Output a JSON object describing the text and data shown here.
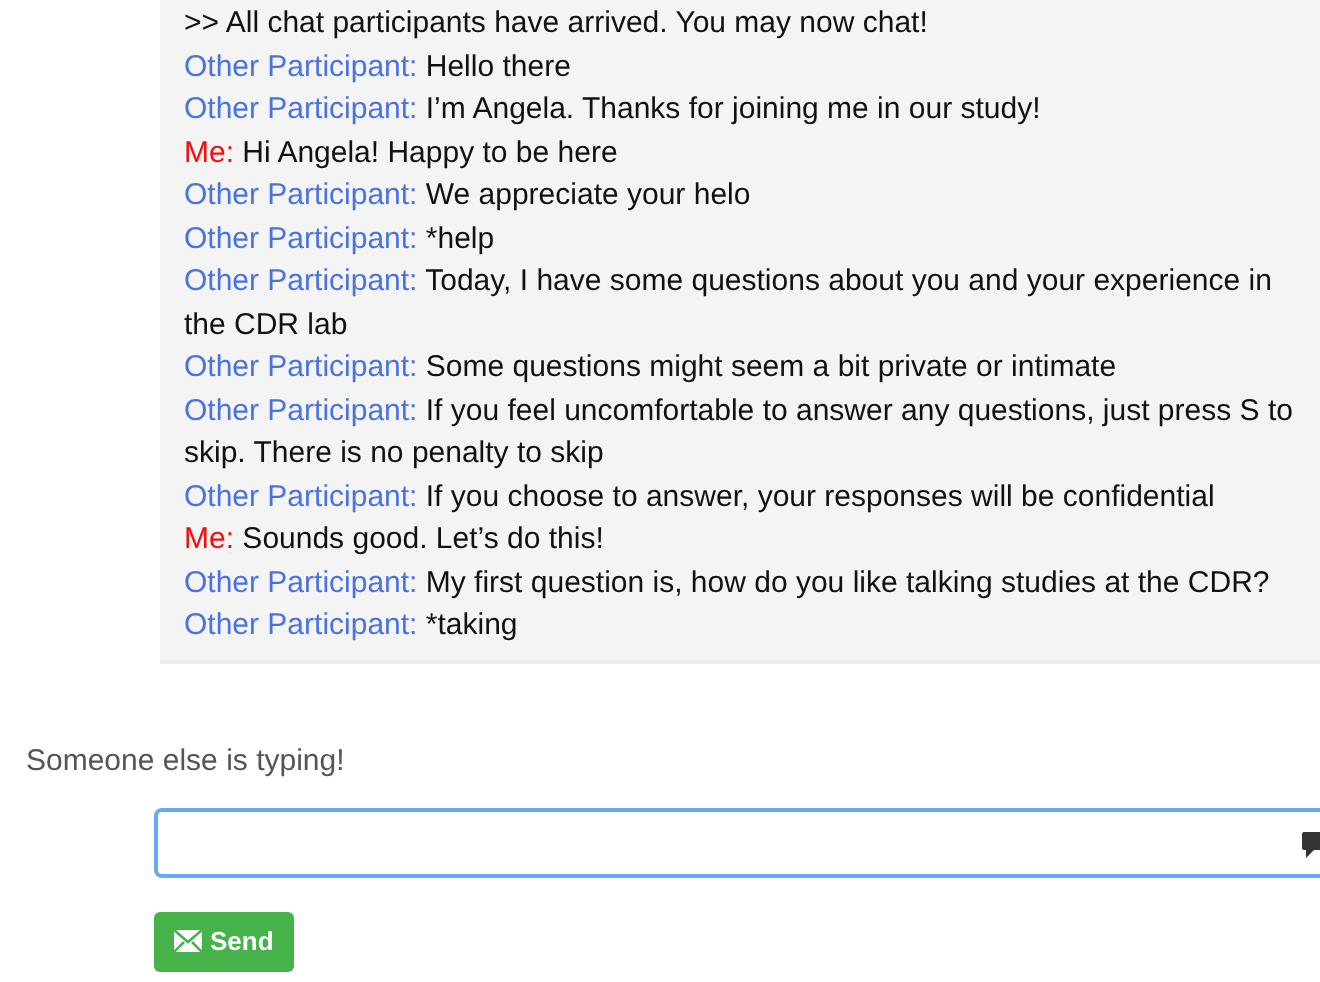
{
  "chat": {
    "system_message": ">> All chat participants have arrived. You may now chat!",
    "messages": [
      {
        "kind": "other",
        "speaker": "Other Participant:",
        "text": "Hello there"
      },
      {
        "kind": "other",
        "speaker": "Other Participant:",
        "text": "I’m Angela. Thanks for joining me in our study!"
      },
      {
        "kind": "me",
        "speaker": "Me:",
        "text": "Hi Angela! Happy to be here"
      },
      {
        "kind": "other",
        "speaker": "Other Participant:",
        "text": "We appreciate your helo"
      },
      {
        "kind": "other",
        "speaker": "Other Participant:",
        "text": "*help"
      },
      {
        "kind": "other",
        "speaker": "Other Participant:",
        "text": "Today, I have some questions about you and your experience in the CDR lab"
      },
      {
        "kind": "other",
        "speaker": "Other Participant:",
        "text": "Some questions might seem a bit private or intimate"
      },
      {
        "kind": "other",
        "speaker": "Other Participant:",
        "text": "If you feel uncomfortable to answer any questions, just press S to skip. There is no penalty to skip"
      },
      {
        "kind": "other",
        "speaker": "Other Participant:",
        "text": "If you choose to answer, your responses will be confidential"
      },
      {
        "kind": "me",
        "speaker": "Me:",
        "text": "Sounds good. Let’s do this!"
      },
      {
        "kind": "other",
        "speaker": "Other Participant:",
        "text": "My first question is, how do you like talking studies at the CDR?"
      },
      {
        "kind": "other",
        "speaker": "Other Participant:",
        "text": "*taking"
      }
    ]
  },
  "typing_status": "Someone else is typing!",
  "send_button": "Send"
}
